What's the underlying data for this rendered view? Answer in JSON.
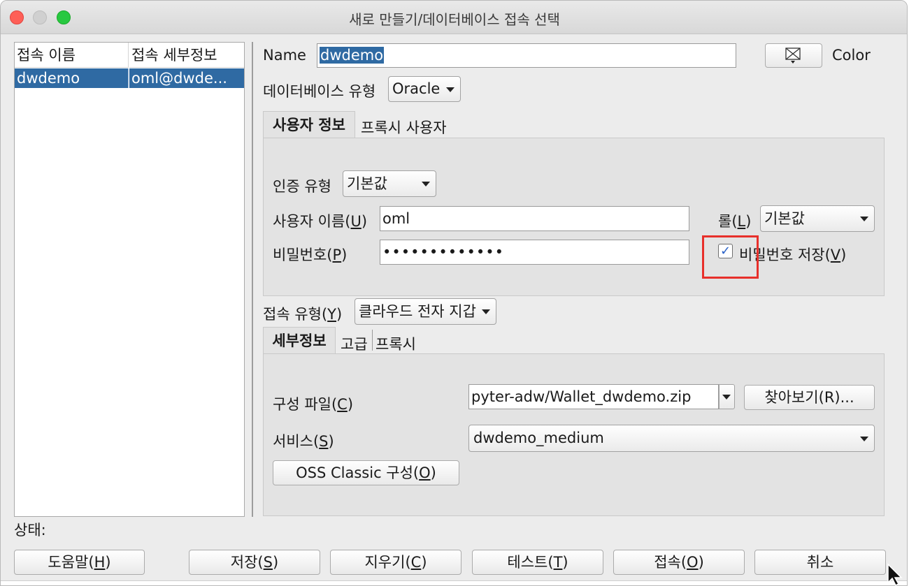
{
  "window": {
    "title": "새로 만들기/데이터베이스 접속 선택"
  },
  "connections": {
    "headers": [
      "접속 이름",
      "접속 세부정보"
    ],
    "rows": [
      {
        "name": "dwdemo",
        "details": "oml@dwde..."
      }
    ]
  },
  "form": {
    "name_label": "Name",
    "name_value": "dwdemo",
    "color_label": "Color",
    "db_type_label": "데이터베이스 유형",
    "db_type_value": "Oracle",
    "tabs_user": [
      "사용자 정보",
      "프록시 사용자"
    ],
    "auth_type_label": "인증 유형",
    "auth_type_value": "기본값",
    "username_label_pre": "사용자 이름(",
    "username_mnemonic": "U",
    "username_label_post": ")",
    "username_value": "oml",
    "role_label_pre": "롤(",
    "role_mnemonic": "L",
    "role_label_post": ")",
    "role_value": "기본값",
    "password_label_pre": "비밀번호(",
    "password_mnemonic": "P",
    "password_label_post": ")",
    "password_value": "•••••••••••••",
    "save_password_pre": "비밀번호 저장(",
    "save_password_mnemonic": "V",
    "save_password_post": ")",
    "save_password_checked": true,
    "conn_type_label_pre": "접속 유형(",
    "conn_type_mnemonic": "Y",
    "conn_type_label_post": ")",
    "conn_type_value": "클라우드 전자 지갑",
    "tabs_detail": [
      "세부정보",
      "고급",
      "프록시"
    ],
    "config_file_label_pre": "구성 파일(",
    "config_file_mnemonic": "C",
    "config_file_label_post": ")",
    "config_file_value": "pyter-adw/Wallet_dwdemo.zip",
    "browse_button": "찾아보기(R)...",
    "service_label_pre": "서비스(",
    "service_mnemonic": "S",
    "service_label_post": ")",
    "service_value": "dwdemo_medium",
    "oss_button_pre": "OSS Classic 구성(",
    "oss_button_mnemonic": "O",
    "oss_button_post": ")"
  },
  "status": {
    "label": "상태:"
  },
  "buttons": {
    "help": {
      "pre": "도움말(",
      "m": "H",
      "post": ")"
    },
    "save": {
      "pre": "저장(",
      "m": "S",
      "post": ")"
    },
    "clear": {
      "pre": "지우기(",
      "m": "C",
      "post": ")"
    },
    "test": {
      "pre": "테스트(",
      "m": "T",
      "post": ")"
    },
    "connect": {
      "pre": "접속(",
      "m": "O",
      "post": ")"
    },
    "cancel": "취소"
  },
  "colors": {
    "selection": "#2f6aa3",
    "highlight_box": "#e8302b",
    "check": "#2a62c8"
  }
}
